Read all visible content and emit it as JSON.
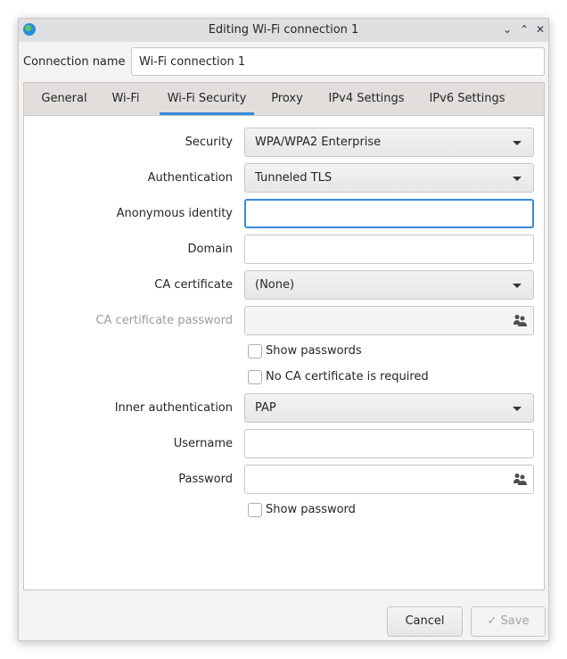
{
  "window": {
    "title": "Editing Wi-Fi connection 1",
    "controls": {
      "minimize": "⌄",
      "maximize": "⌃",
      "close": "✕"
    }
  },
  "connection_name": {
    "label": "Connection name",
    "value": "Wi-Fi connection 1"
  },
  "tabs": [
    {
      "label": "General",
      "active": false
    },
    {
      "label": "Wi-Fi",
      "active": false
    },
    {
      "label": "Wi-Fi Security",
      "active": true
    },
    {
      "label": "Proxy",
      "active": false
    },
    {
      "label": "IPv4 Settings",
      "active": false
    },
    {
      "label": "IPv6 Settings",
      "active": false
    }
  ],
  "form": {
    "security": {
      "label": "Security",
      "value": "WPA/WPA2 Enterprise"
    },
    "authentication": {
      "label": "Authentication",
      "value": "Tunneled TLS"
    },
    "anonymous_identity": {
      "label": "Anonymous identity",
      "value": ""
    },
    "domain": {
      "label": "Domain",
      "value": ""
    },
    "ca_certificate": {
      "label": "CA certificate",
      "value": "(None)"
    },
    "ca_certificate_password": {
      "label": "CA certificate password",
      "value": ""
    },
    "show_passwords": {
      "label": "Show passwords",
      "checked": false
    },
    "no_ca_required": {
      "label": "No CA certificate is required",
      "checked": false
    },
    "inner_authentication": {
      "label": "Inner authentication",
      "value": "PAP"
    },
    "username": {
      "label": "Username",
      "value": ""
    },
    "password": {
      "label": "Password",
      "value": ""
    },
    "show_password": {
      "label": "Show password",
      "checked": false
    }
  },
  "buttons": {
    "cancel": "Cancel",
    "save": "✓ Save"
  },
  "colors": {
    "accent": "#3889d8"
  }
}
